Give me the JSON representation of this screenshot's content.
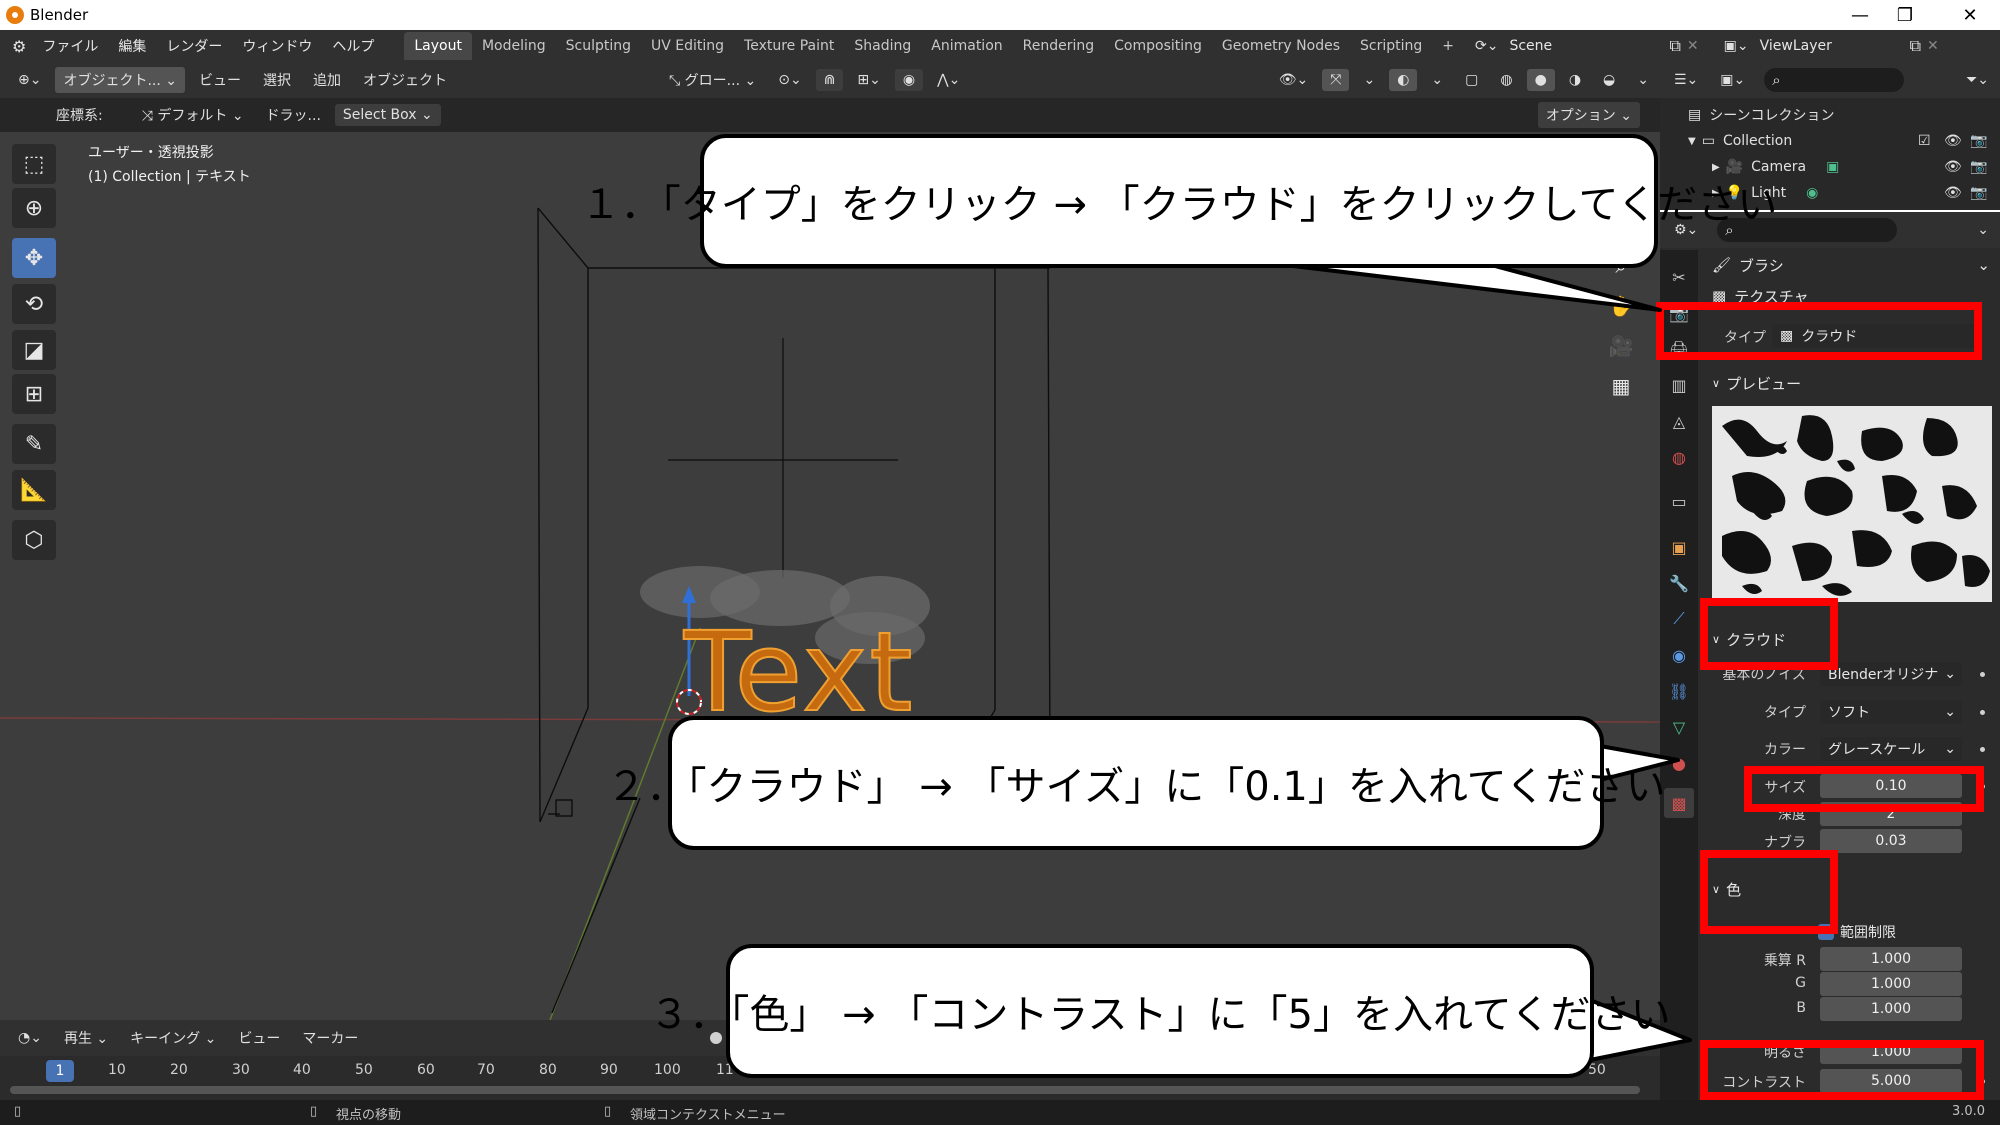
{
  "window": {
    "title": "Blender"
  },
  "menu": [
    "ファイル",
    "編集",
    "レンダー",
    "ウィンドウ",
    "ヘルプ"
  ],
  "workspaces": [
    "Layout",
    "Modeling",
    "Sculpting",
    "UV Editing",
    "Texture Paint",
    "Shading",
    "Animation",
    "Rendering",
    "Compositing",
    "Geometry Nodes",
    "Scripting"
  ],
  "scene": "Scene",
  "view_layer": "ViewLayer",
  "viewport": {
    "mode": "オブジェクト...",
    "menus": [
      "ビュー",
      "選択",
      "追加",
      "オブジェクト"
    ],
    "transform": "グロー...",
    "coords_label": "座標系:",
    "orientation": "デフォルト",
    "drag": "ドラッ...",
    "select_mode": "Select Box",
    "options": "オプション",
    "view_name": "ユーザー・透視投影",
    "collection_info": "(1) Collection | テキスト",
    "text_object": "Text"
  },
  "outliner": {
    "root": "シーンコレクション",
    "collection": "Collection",
    "items": [
      "Camera",
      "Light"
    ]
  },
  "properties": {
    "context": "ブラシ",
    "texture_label": "テクスチャ",
    "type_label": "タイプ",
    "type_value": "クラウド",
    "preview_label": "プレビュー",
    "cloud_panel": "クラウド",
    "basis_label": "基本のノイズ",
    "basis_value": "Blenderオリジナ",
    "cloud_type_label": "タイプ",
    "cloud_type_value": "ソフト",
    "color_label": "カラー",
    "color_value": "グレースケール",
    "size_label": "サイズ",
    "size_value": "0.10",
    "depth_label": "深度",
    "depth_value": "2",
    "nabla_label": "ナブラ",
    "nabla_value": "0.03",
    "color_panel": "色",
    "clamp_label": "範囲制限",
    "mult_r_label": "乗算 R",
    "mult_r": "1.000",
    "g_label": "G",
    "g": "1.000",
    "b_label": "B",
    "b": "1.000",
    "brightness_label": "明るさ",
    "brightness": "1.000",
    "contrast_label": "コントラスト",
    "contrast": "5.000"
  },
  "timeline": {
    "playback": "再生",
    "keying": "キーイング",
    "view": "ビュー",
    "marker": "マーカー",
    "current_frame": "1",
    "ticks": [
      "10",
      "20",
      "30",
      "40",
      "50",
      "60",
      "70",
      "80",
      "90",
      "100",
      "11"
    ],
    "right_tick": "50"
  },
  "statusbar": {
    "left": "視点の移動",
    "middle": "領域コンテクストメニュー",
    "version": "3.0.0"
  },
  "callouts": {
    "step1": "１．「タイプ」をクリック → 「クラウド」をクリックしてください",
    "step2": "２．「クラウド」 → 「サイズ」に「0.1」を入れてください",
    "step3": "３．「色」 → 「コントラスト」に「5」を入れてください"
  },
  "colors": {
    "accent": "#4772b3",
    "highlight": "#ff0000",
    "text_object": "#e87d0d"
  }
}
